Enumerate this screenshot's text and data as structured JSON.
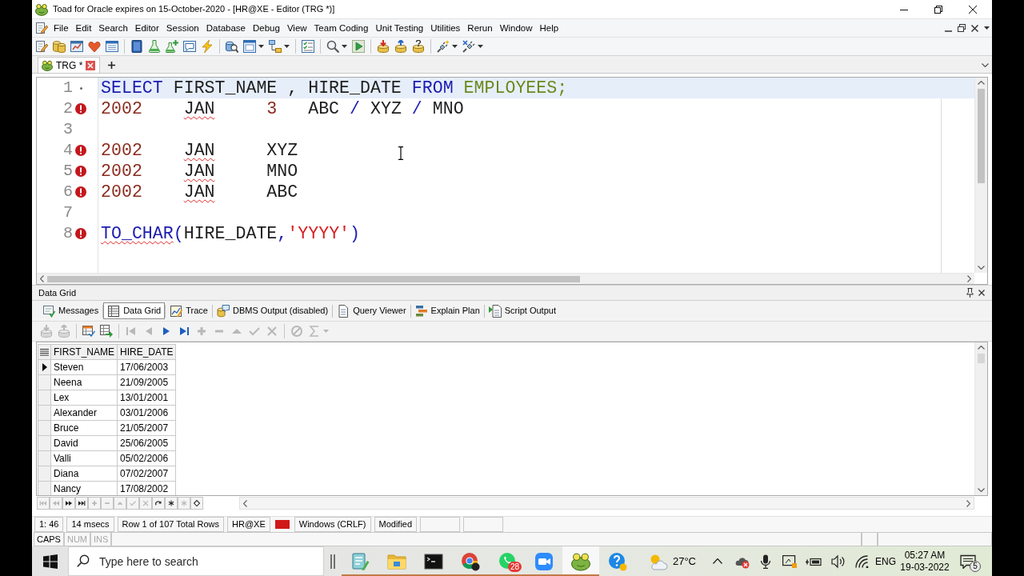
{
  "window": {
    "title": "Toad for Oracle expires on 15-October-2020 - [HR@XE - Editor (TRG *)]"
  },
  "menu": [
    "File",
    "Edit",
    "Search",
    "Editor",
    "Session",
    "Database",
    "Debug",
    "View",
    "Team Coding",
    "Unit Testing",
    "Utilities",
    "Rerun",
    "Window",
    "Help"
  ],
  "editor_tabs": [
    {
      "label": "TRG *",
      "selected": true
    }
  ],
  "editor": {
    "lines": [
      {
        "number": "1",
        "error": false,
        "current": true,
        "tokens": [
          {
            "kind": "keyword",
            "text": "SELECT",
            "squiggle": false
          },
          {
            "kind": "plain",
            "text": " FIRST_NAME , HIRE_DATE ",
            "squiggle": false
          },
          {
            "kind": "keyword",
            "text": "FROM",
            "squiggle": false
          },
          {
            "kind": "table",
            "text": " EMPLOYEES;",
            "squiggle": false
          }
        ]
      },
      {
        "number": "2",
        "error": true,
        "current": false,
        "tokens": [
          {
            "kind": "number",
            "text": "2002    ",
            "squiggle": false
          },
          {
            "kind": "plain",
            "text": "JAN",
            "squiggle": true
          },
          {
            "kind": "number",
            "text": "     3",
            "squiggle": false
          },
          {
            "kind": "plain",
            "text": "   ABC ",
            "squiggle": false
          },
          {
            "kind": "operator",
            "text": "/",
            "squiggle": false
          },
          {
            "kind": "plain",
            "text": " XYZ ",
            "squiggle": false
          },
          {
            "kind": "operator",
            "text": "/",
            "squiggle": false
          },
          {
            "kind": "plain",
            "text": " MNO",
            "squiggle": false
          }
        ]
      },
      {
        "number": "3",
        "error": false,
        "current": false
      },
      {
        "number": "4",
        "error": true,
        "current": false,
        "tokens": [
          {
            "kind": "number",
            "text": "2002    ",
            "squiggle": false
          },
          {
            "kind": "plain",
            "text": "JAN",
            "squiggle": true
          },
          {
            "kind": "plain",
            "text": "     XYZ",
            "squiggle": false
          }
        ]
      },
      {
        "number": "5",
        "error": true,
        "current": false,
        "tokens": [
          {
            "kind": "number",
            "text": "2002    ",
            "squiggle": false
          },
          {
            "kind": "plain",
            "text": "JAN",
            "squiggle": true
          },
          {
            "kind": "plain",
            "text": "     MNO",
            "squiggle": false
          }
        ]
      },
      {
        "number": "6",
        "error": true,
        "current": false,
        "tokens": [
          {
            "kind": "number",
            "text": "2002    ",
            "squiggle": false
          },
          {
            "kind": "plain",
            "text": "JAN",
            "squiggle": true
          },
          {
            "kind": "plain",
            "text": "     ABC",
            "squiggle": false
          }
        ]
      },
      {
        "number": "7",
        "error": false,
        "current": false
      },
      {
        "number": "8",
        "error": true,
        "current": false,
        "tokens": [
          {
            "kind": "keyword",
            "text": "TO_CHAR",
            "squiggle": true
          },
          {
            "kind": "operator",
            "text": "(",
            "squiggle": false
          },
          {
            "kind": "plain",
            "text": "HIRE_DATE",
            "squiggle": false
          },
          {
            "kind": "operator",
            "text": ",",
            "squiggle": false
          },
          {
            "kind": "string",
            "text": "'YYYY'",
            "squiggle": false
          },
          {
            "kind": "operator",
            "text": ")",
            "squiggle": false
          }
        ]
      }
    ]
  },
  "results": {
    "title": "Data Grid",
    "tabs": [
      {
        "label": "Messages",
        "selected": false
      },
      {
        "label": "Data Grid",
        "selected": true
      },
      {
        "label": "Trace",
        "selected": false
      },
      {
        "label": "DBMS Output (disabled)",
        "selected": false
      },
      {
        "label": "Query Viewer",
        "selected": false
      },
      {
        "label": "Explain Plan",
        "selected": false
      },
      {
        "label": "Script Output",
        "selected": false
      }
    ],
    "toolbar": [
      [
        {
          "kind": "import",
          "disabled": true
        },
        {
          "kind": "export",
          "disabled": true
        }
      ],
      [
        {
          "kind": "copy-grid",
          "disabled": false
        },
        {
          "kind": "grid-arrow",
          "disabled": false
        }
      ],
      [
        {
          "kind": "first",
          "disabled": true
        },
        {
          "kind": "prior",
          "disabled": true
        },
        {
          "kind": "next",
          "disabled": false
        },
        {
          "kind": "last",
          "disabled": false
        },
        {
          "kind": "insert",
          "disabled": true
        },
        {
          "kind": "delete",
          "disabled": true
        },
        {
          "kind": "edit",
          "disabled": true
        },
        {
          "kind": "post",
          "disabled": true
        },
        {
          "kind": "cancel",
          "disabled": true
        }
      ],
      [
        {
          "kind": "clear",
          "disabled": true
        },
        {
          "kind": "sum",
          "disabled": true
        }
      ]
    ],
    "grid": {
      "columns": [
        "FIRST_NAME",
        "HIRE_DATE"
      ],
      "rows": [
        {
          "cells": [
            "Steven",
            "17/06/2003"
          ],
          "selected": true
        },
        {
          "cells": [
            "Neena",
            "21/09/2005"
          ],
          "selected": false
        },
        {
          "cells": [
            "Lex",
            "13/01/2001"
          ],
          "selected": false
        },
        {
          "cells": [
            "Alexander",
            "03/01/2006"
          ],
          "selected": false
        },
        {
          "cells": [
            "Bruce",
            "21/05/2007"
          ],
          "selected": false
        },
        {
          "cells": [
            "David",
            "25/06/2005"
          ],
          "selected": false
        },
        {
          "cells": [
            "Valli",
            "05/02/2006"
          ],
          "selected": false
        },
        {
          "cells": [
            "Diana",
            "07/02/2007"
          ],
          "selected": false
        },
        {
          "cells": [
            "Nancy",
            "17/08/2002"
          ],
          "selected": false
        }
      ]
    },
    "navigator": [
      {
        "kind": "first",
        "disabled": true
      },
      {
        "kind": "prior",
        "disabled": true
      },
      {
        "kind": "next",
        "disabled": false
      },
      {
        "kind": "last",
        "disabled": false
      },
      {
        "kind": "insert",
        "disabled": true
      },
      {
        "kind": "delete",
        "disabled": true
      },
      {
        "kind": "edit",
        "disabled": true
      },
      {
        "kind": "post",
        "disabled": true
      },
      {
        "kind": "cancel",
        "disabled": true
      },
      {
        "kind": "refresh",
        "disabled": false
      },
      {
        "kind": "asterisk",
        "disabled": false
      },
      {
        "kind": "asterisk",
        "disabled": true
      },
      {
        "kind": "diamond",
        "disabled": false
      }
    ]
  },
  "status_bar": {
    "panels": [
      {
        "kind": "text",
        "text": "1: 46"
      },
      {
        "kind": "text",
        "text": "14 msecs"
      },
      {
        "kind": "text",
        "text": "Row 1 of 107 Total Rows"
      },
      {
        "kind": "text",
        "text": "HR@XE"
      },
      {
        "kind": "color",
        "color": "#d01818"
      },
      {
        "kind": "text",
        "text": "Windows (CRLF)"
      },
      {
        "kind": "text",
        "text": "Modified"
      },
      {
        "kind": "empty"
      },
      {
        "kind": "empty"
      }
    ],
    "keys": [
      {
        "label": "CAPS",
        "on": true
      },
      {
        "label": "NUM",
        "on": false
      },
      {
        "label": "INS",
        "on": false
      }
    ]
  },
  "taskbar": {
    "search": {
      "placeholder": "Type here to search"
    },
    "apps": [
      {
        "kind": "notebook",
        "running": true,
        "selected": false
      },
      {
        "kind": "folder",
        "running": true,
        "selected": false
      },
      {
        "kind": "terminal",
        "running": true,
        "selected": false
      },
      {
        "kind": "browser",
        "running": true,
        "selected": false
      },
      {
        "kind": "chat",
        "running": true,
        "selected": false,
        "badge": "28"
      },
      {
        "kind": "video",
        "running": true,
        "selected": false
      },
      {
        "kind": "frog",
        "running": true,
        "selected": true
      },
      {
        "kind": "help",
        "running": false,
        "selected": false
      }
    ],
    "weather": {
      "temperature": "27°C"
    },
    "language": "ENG",
    "clock": {
      "time": "05:27 AM",
      "date": "19-03-2022"
    },
    "notification_count": "5"
  }
}
